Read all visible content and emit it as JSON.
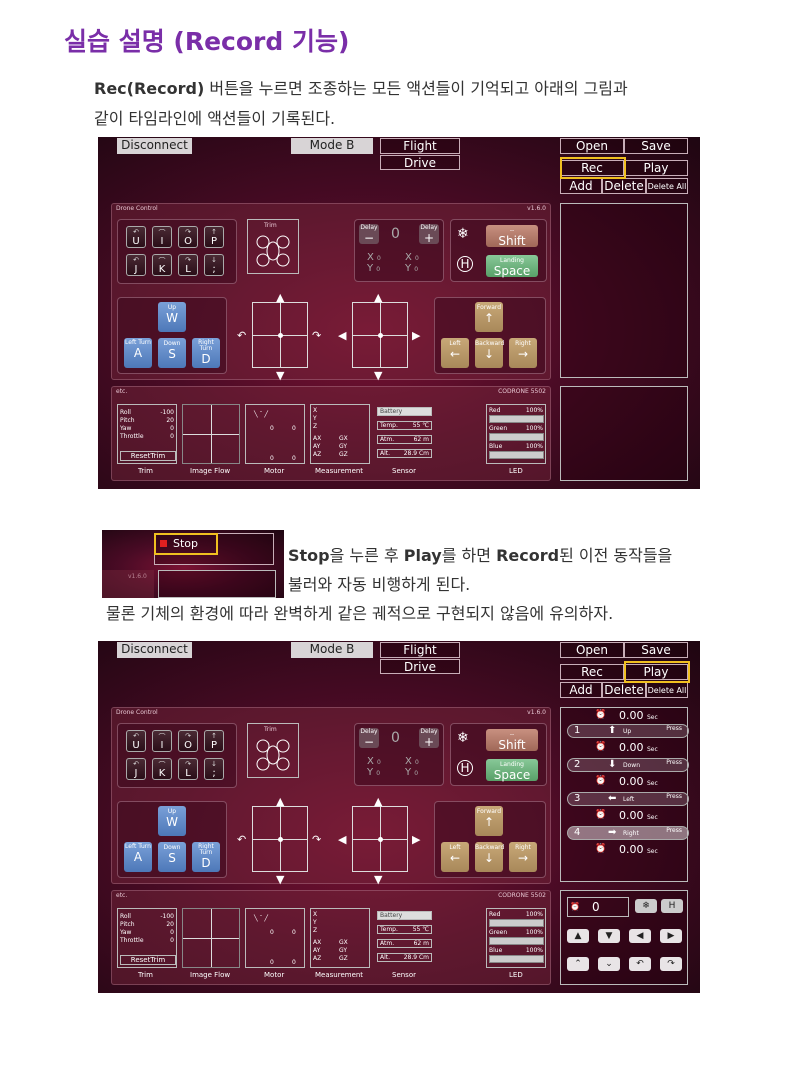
{
  "title": "실습 설명 (Record 기능)",
  "intro": {
    "bold": "Rec(Record)",
    "line1_rest": "  버튼을 누르면 조종하는 모든 액션들이 기억되고 아래의 그림과",
    "line2": "같이 타임라인에 액션들이 기록된다."
  },
  "app": {
    "disconnect": "Disconnect",
    "mode": "Mode B",
    "flight": "Flight",
    "drive": "Drive",
    "open": "Open",
    "save": "Save",
    "rec": "Rec",
    "play": "Play",
    "add": "Add",
    "delete": "Delete",
    "delete_all": "Delete All",
    "panel_drone": "Drone Control",
    "version": "v1.6.0",
    "keys_row1": [
      "U",
      "I",
      "O",
      "P"
    ],
    "keys_row2": [
      "J",
      "K",
      "L",
      ";"
    ],
    "trim": "Trim",
    "delay": "Delay",
    "delay_value": "0",
    "x_lbl": "X",
    "y_lbl": "Y",
    "zero": "0",
    "shift_top": "--",
    "shift": "Shift",
    "landing": "Landing",
    "space": "Space",
    "up": "Up",
    "w": "W",
    "left_turn": "Left Turn",
    "down": "Down",
    "right_turn": "Right Turn",
    "a": "A",
    "s": "S",
    "d": "D",
    "forward": "Forward",
    "left": "Left",
    "backward": "Backward",
    "right": "Right",
    "etc": "etc.",
    "codrone": "CODRONE 5502",
    "trim_rows": [
      [
        "Roll",
        "-100"
      ],
      [
        "Pitch",
        "20"
      ],
      [
        "Yaw",
        "0"
      ],
      [
        "Throttle",
        "0"
      ]
    ],
    "reset_trim": "ResetTrim",
    "footer": [
      "Trim",
      "Image Flow",
      "Motor",
      "Measurement",
      "Sensor",
      "LED"
    ],
    "meas": [
      "X",
      "Y",
      "Z"
    ],
    "ax": [
      "AX",
      "AY",
      "AZ"
    ],
    "gx": [
      "GX",
      "GY",
      "GZ"
    ],
    "battery": "Battery",
    "temp": "Temp.",
    "temp_val": "55 ℃",
    "atm": "Atm.",
    "atm_val": "62 m",
    "alt": "Alt.",
    "alt_val": "28.9 Cm",
    "led": [
      [
        "Red",
        "100%"
      ],
      [
        "Green",
        "100%"
      ],
      [
        "Blue",
        "100%"
      ]
    ]
  },
  "stop": {
    "label": "Stop",
    "version": "v1.6.0",
    "bold1": "Stop",
    "t1": "을 누른 후 ",
    "bold2": "Play",
    "t2": "를 하면 ",
    "bold3": "Record",
    "t3": "된 이전 동작들을",
    "line2": "불러와 자동 비행하게 된다.",
    "line3": "물론 기체의 환경에 따라 완벽하게 같은 궤적으로 구현되지 않음에 유의하자."
  },
  "timeline": [
    {
      "n": "1",
      "time": "0.00",
      "unit": "Sec",
      "action": "Up",
      "press": "Press"
    },
    {
      "n": "2",
      "time": "0.00",
      "unit": "Sec",
      "action": "Down",
      "press": "Press"
    },
    {
      "n": "3",
      "time": "0.00",
      "unit": "Sec",
      "action": "Left",
      "press": "Press"
    },
    {
      "n": "4",
      "time": "0.00",
      "unit": "Sec",
      "action": "Right",
      "press": "Press"
    }
  ],
  "timeline_first_time": "0.00",
  "player_value": "0",
  "icons": [
    "snowflake-icon",
    "helipad-icon",
    "arrow-up-icon",
    "arrow-down-icon",
    "arrow-left-icon",
    "arrow-right-icon",
    "clock-icon"
  ]
}
